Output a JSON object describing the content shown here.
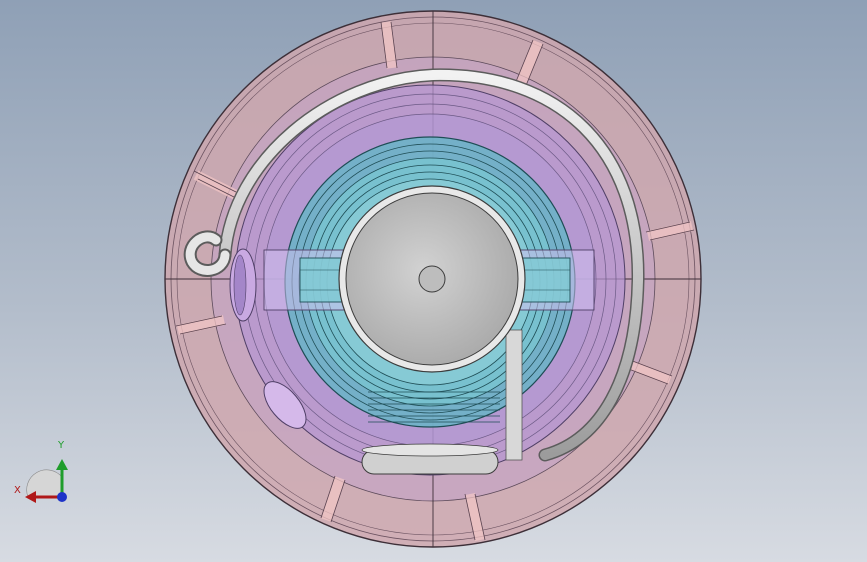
{
  "view": {
    "background_top": "#8fa0b6",
    "background_bottom": "#d7dbe2"
  },
  "model": {
    "shell_color": "#d3a9b1",
    "inner_color": "#b79ad1",
    "bearing_color": "#64bac5",
    "hub_color": "#c6c6c6",
    "wire_color": "#d9d9d9",
    "edge_color": "#4a3b45"
  },
  "triad": {
    "x_label": "X",
    "y_label": "Y",
    "x_color": "#b01818",
    "y_color": "#1f9d2c",
    "z_color": "#1e33c8"
  }
}
